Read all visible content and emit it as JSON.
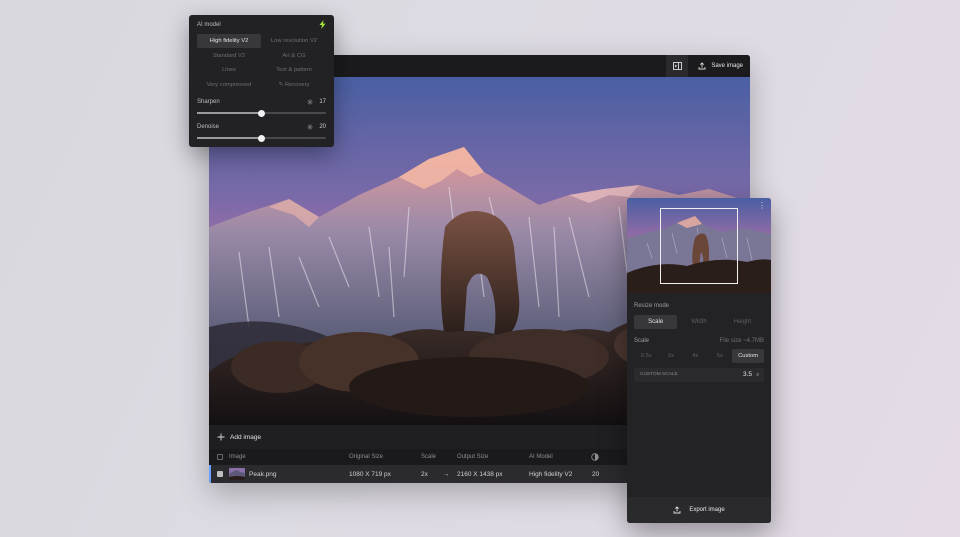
{
  "main_window": {
    "toolbar": {
      "save_label": "Save image"
    },
    "bottom_bar": {
      "add_image_label": "Add image"
    },
    "table": {
      "headers": {
        "image": "Image",
        "original_size": "Original Size",
        "scale": "Scale",
        "output_size": "Output Size",
        "ai_model": "AI Model"
      },
      "rows": [
        {
          "name": "Peak.png",
          "original_size": "1080 X 719 px",
          "scale": "2x",
          "arrow": "→",
          "output_size": "2160 X 1438 px",
          "ai_model": "High fidelity V2",
          "value": "20"
        }
      ]
    }
  },
  "ai_model_panel": {
    "title": "AI model",
    "models": [
      {
        "label": "High fidelity V2",
        "active": true
      },
      {
        "label": "Low resolution V2",
        "active": false
      },
      {
        "label": "Standard V2",
        "active": false
      },
      {
        "label": "Art & CG",
        "active": false
      },
      {
        "label": "Lines",
        "active": false
      },
      {
        "label": "Text & pattern",
        "active": false
      },
      {
        "label": "Very compressed",
        "active": false
      },
      {
        "label": "✎ Recovery",
        "active": false
      }
    ],
    "sharpen": {
      "label": "Sharpen",
      "value": 17,
      "fraction": 0.5
    },
    "denoise": {
      "label": "Denoise",
      "value": 20,
      "fraction": 0.5
    }
  },
  "right_panel": {
    "resize_mode": {
      "label": "Resize mode",
      "options": [
        "Scale",
        "Width",
        "Height"
      ],
      "active": "Scale"
    },
    "scale": {
      "label": "Scale",
      "file_size": "File size ~4.7MB",
      "options": [
        "0.5x",
        "2x",
        "4x",
        "6x",
        "Custom"
      ],
      "active": "Custom"
    },
    "custom_scale": {
      "label": "CUSTOM SCALE",
      "value": "3.5",
      "unit": "x"
    },
    "export_label": "Export image"
  },
  "colors": {
    "accent": "#6aa0ff",
    "bolt": "#a3e635"
  }
}
